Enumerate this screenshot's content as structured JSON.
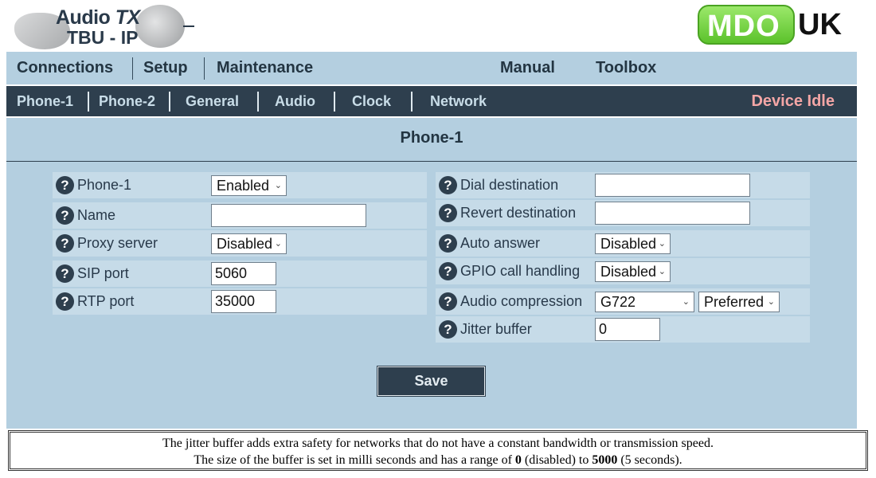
{
  "brand": {
    "product_line1_prefix": "Audio ",
    "product_line1_mark": "TX",
    "product_line2": "TBU - IP",
    "company_pill": "MDO",
    "company_suffix": "UK",
    "pill_color": "#6cd039"
  },
  "nav_primary": {
    "items": [
      "Connections",
      "Setup",
      "Maintenance"
    ],
    "right_items": [
      "Manual",
      "Toolbox"
    ]
  },
  "nav_secondary": {
    "items": [
      "Phone-1",
      "Phone-2",
      "General",
      "Audio",
      "Clock",
      "Network"
    ],
    "status": "Device Idle",
    "status_color": "#f4a6a6"
  },
  "panel": {
    "title": "Phone-1",
    "left_fields": [
      {
        "label": "Phone-1",
        "type": "select",
        "value": "Enabled"
      },
      {
        "label": "Name",
        "type": "input",
        "value": ""
      },
      {
        "label": "Proxy server",
        "type": "select",
        "value": "Disabled"
      },
      {
        "label": "SIP port",
        "type": "input",
        "value": "5060"
      },
      {
        "label": "RTP port",
        "type": "input",
        "value": "35000"
      }
    ],
    "right_fields": [
      {
        "label": "Dial destination",
        "type": "input",
        "value": ""
      },
      {
        "label": "Revert destination",
        "type": "input",
        "value": ""
      },
      {
        "label": "Auto answer",
        "type": "select",
        "value": "Disabled"
      },
      {
        "label": "GPIO call handling",
        "type": "select",
        "value": "Disabled"
      },
      {
        "label": "Audio compression",
        "type": "select",
        "value": "G722",
        "second_value": "Preferred"
      },
      {
        "label": "Jitter buffer",
        "type": "input",
        "value": "0"
      }
    ],
    "help_glyph": "?",
    "save_label": "Save"
  },
  "info": {
    "line1": "The jitter buffer adds extra safety for networks that do not have a constant bandwidth or transmission speed.",
    "line2_a": "The size of the buffer is set in milli seconds and has a range of ",
    "line2_min": "0",
    "line2_b": " (disabled) to ",
    "line2_max": "5000",
    "line2_c": " (5 seconds)."
  },
  "colors": {
    "nav_light": "#b4cfe0",
    "nav_dark": "#2e3f4e",
    "row_bg": "#c6dbe8"
  }
}
